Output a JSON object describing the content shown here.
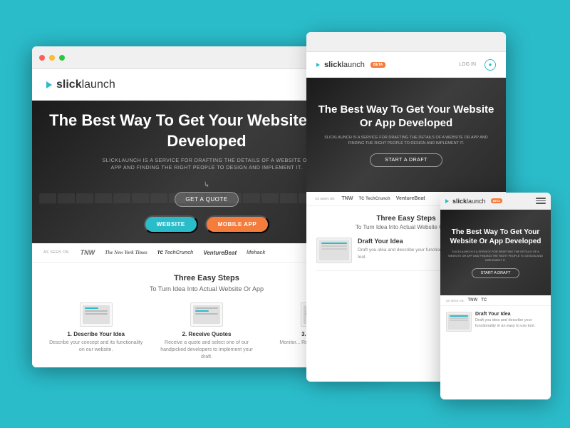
{
  "background_color": "#2bbcca",
  "main_browser": {
    "nav": {
      "logo_slick": "slick",
      "logo_launch": "launch"
    },
    "hero": {
      "title": "The Best Way To Get Your Website Or App Developed",
      "subtitle": "SLICKLAUNCH IS A SERVICE FOR DRAFTING THE DETAILS OF A WEBSITE OR APP AND FINDING THE RIGHT PEOPLE TO DESIGN AND IMPLEMENT IT.",
      "cta_label": "GET A QUOTE",
      "btn_website": "WEBSITE",
      "btn_mobile": "MOBILE APP"
    },
    "as_seen": {
      "label": "AS SEEN ON",
      "logos": [
        "TNW",
        "The New York Times",
        "TechCrunch",
        "VentureBeat",
        "lifehack"
      ]
    },
    "steps": {
      "title": "Three Easy Steps",
      "subtitle": "To Turn Idea Into Actual Website Or App",
      "items": [
        {
          "number": "1.",
          "label": "Describe Your Idea",
          "description": "Describe your concept and its functionality on our website."
        },
        {
          "number": "2.",
          "label": "Receive Quotes",
          "description": "Receive a quote and select one of our handpicked developers to implement your draft."
        },
        {
          "number": "3.",
          "label": "Monitor...",
          "description": "Monitor... Receive feedback and..."
        }
      ]
    }
  },
  "medium_browser": {
    "nav": {
      "logo_slick": "slick",
      "logo_launch": "launch",
      "badge": "BETA",
      "login": "LOG IN"
    },
    "hero": {
      "title": "The Best Way To Get Your Website Or App Developed",
      "subtitle": "SLICKLAUNCH IS A SERVICE FOR DRAFTING THE DETAILS OF A WEBSITE OR APP AND FINDING THE RIGHT PEOPLE TO DESIGN AND IMPLEMENT IT.",
      "btn_draft": "START A DRAFT"
    },
    "as_seen": {
      "label": "AS SEEN ON",
      "logos": [
        "TNW",
        "TechCrunch",
        "VentureBeat"
      ]
    },
    "steps": {
      "title": "Three Easy Steps",
      "subtitle": "To Turn Idea Into Actual Website Or App",
      "items": [
        {
          "label": "Draft Your Idea",
          "description": "Draft you idea and describe your functionality in an easy to use tool."
        }
      ]
    }
  },
  "small_browser": {
    "nav": {
      "logo_slick": "slick",
      "logo_launch": "launch",
      "badge": "BETA",
      "menu": "MENU"
    },
    "hero": {
      "title": "The Best Way To Get Your Website Or App Developed",
      "subtitle": "SLICKLAUNCH IS A SERVICE FOR DRAFTING THE DETAILS OF A WEBSITE OR APP AND FINDING THE RIGHT PEOPLE TO DESIGN AND IMPLEMENT IT.",
      "btn_draft": "START A DRAFT"
    },
    "as_seen": {
      "label": "AS SEEN ON",
      "logos": [
        "TNW",
        "TC"
      ]
    }
  }
}
